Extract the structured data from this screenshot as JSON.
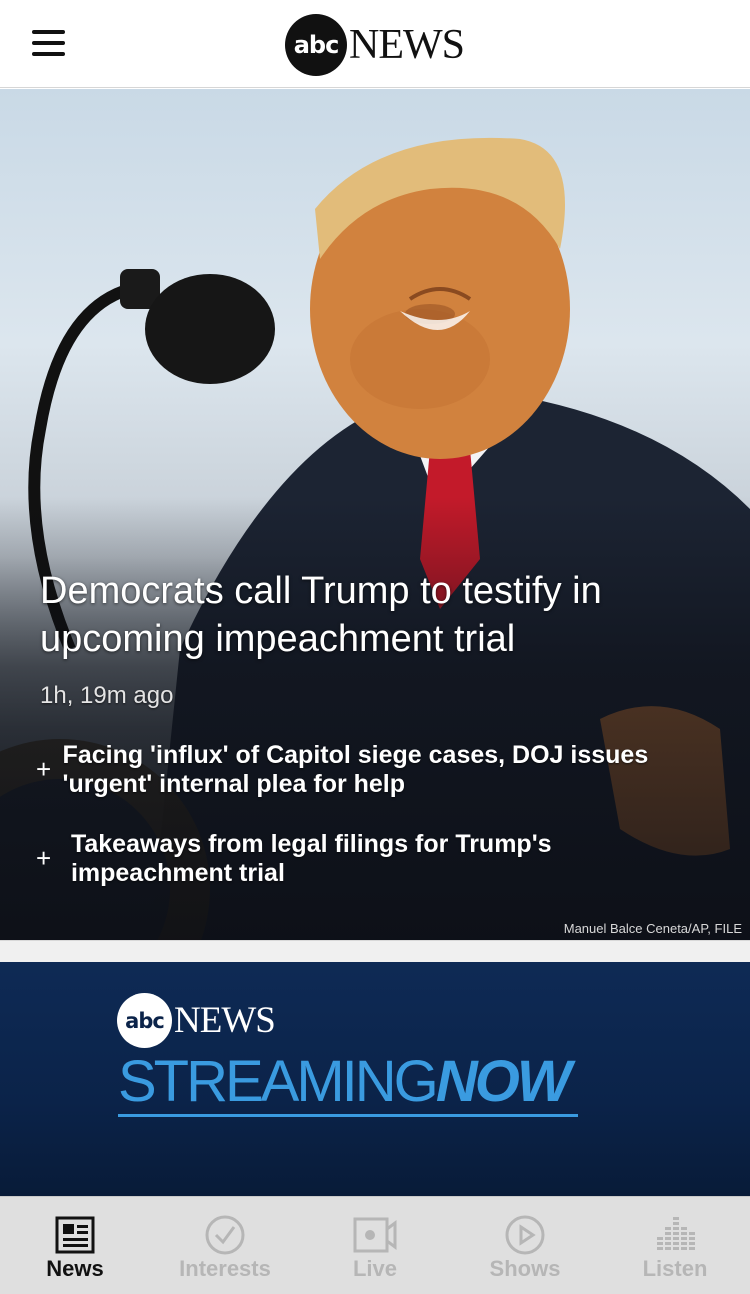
{
  "header": {
    "logo_abc": "abc",
    "logo_news": "NEWS"
  },
  "hero": {
    "headline": "Democrats call Trump to testify in upcoming impeachment trial",
    "time": "1h, 19m ago",
    "related": [
      {
        "icon": "+",
        "text": "Facing 'influx' of Capitol siege cases, DOJ issues 'urgent' internal plea for help"
      },
      {
        "icon": "+",
        "text": "Takeaways from legal filings for Trump's impeachment trial"
      }
    ],
    "credit": "Manuel Balce Ceneta/AP, FILE"
  },
  "stream_banner": {
    "logo_abc": "abc",
    "logo_news": "NEWS",
    "streaming": "STREAMING",
    "now": "NOW",
    "accent_color": "#3a9be0"
  },
  "tabbar": {
    "tabs": [
      {
        "label": "News",
        "icon": "newspaper-icon",
        "active": true
      },
      {
        "label": "Interests",
        "icon": "checkmark-circle-icon",
        "active": false
      },
      {
        "label": "Live",
        "icon": "video-camera-icon",
        "active": false
      },
      {
        "label": "Shows",
        "icon": "play-circle-icon",
        "active": false
      },
      {
        "label": "Listen",
        "icon": "audio-bars-icon",
        "active": false
      }
    ]
  }
}
